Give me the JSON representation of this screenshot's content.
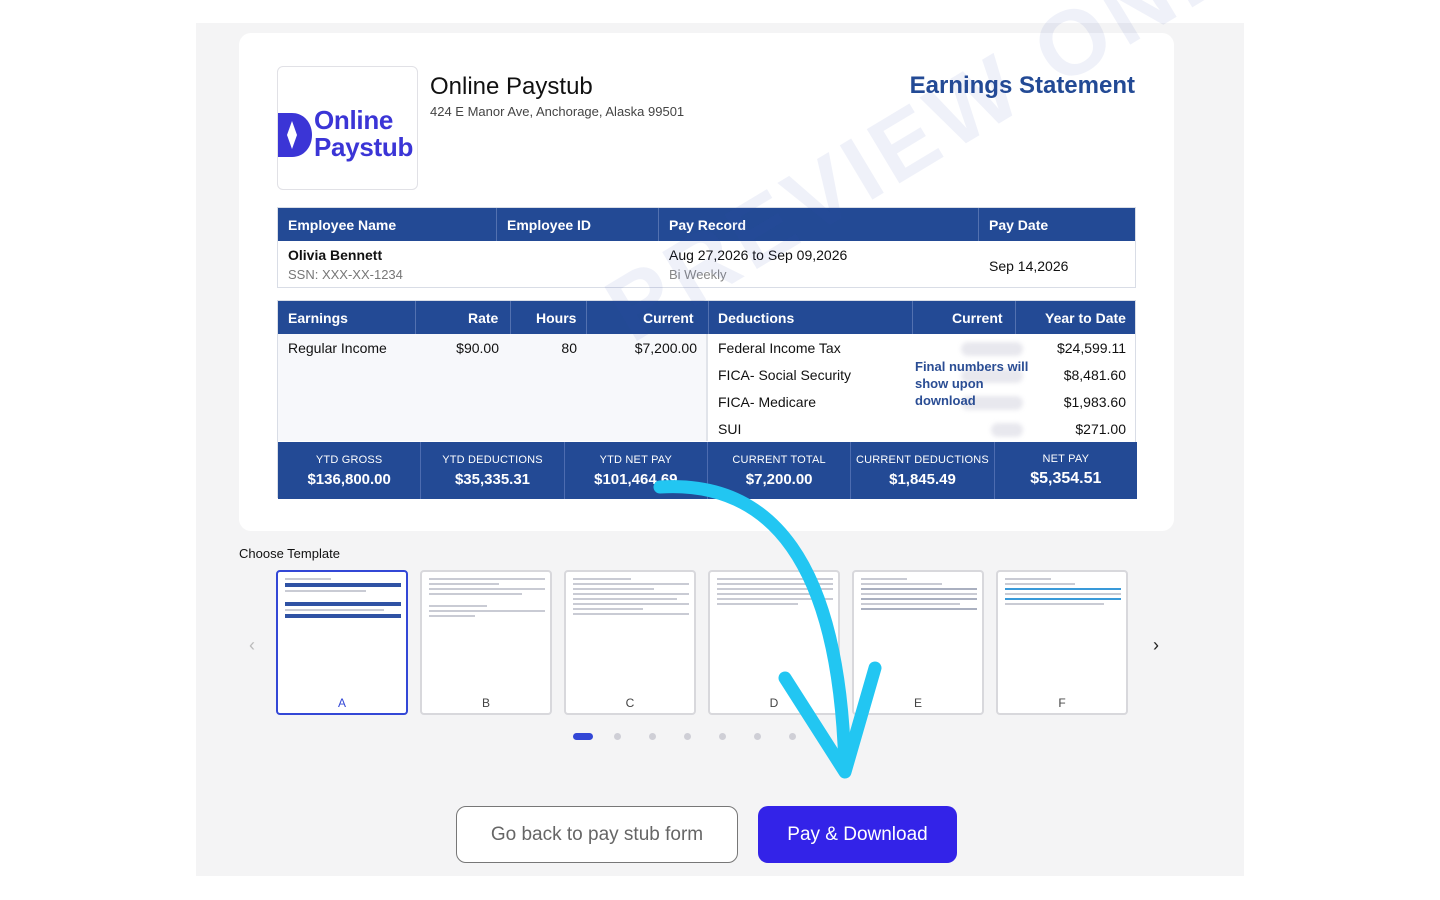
{
  "company": {
    "logo_line1": "Online",
    "logo_line2": "Paystub",
    "name": "Online Paystub",
    "address": "424 E Manor Ave, Anchorage, Alaska 99501",
    "statement_title": "Earnings Statement"
  },
  "employee_table": {
    "headers": [
      "Employee Name",
      "Employee ID",
      "Pay Record",
      "Pay Date"
    ],
    "employee_name": "Olivia Bennett",
    "ssn": "SSN: XXX-XX-1234",
    "pay_record": "Aug 27,2026 to Sep 09,2026",
    "pay_frequency": "Bi Weekly",
    "pay_date": "Sep 14,2026"
  },
  "earnings": {
    "headers": [
      "Earnings",
      "Rate",
      "Hours",
      "Current"
    ],
    "rows": [
      {
        "label": "Regular Income",
        "rate": "$90.00",
        "hours": "80",
        "current": "$7,200.00"
      }
    ]
  },
  "deductions": {
    "headers": [
      "Deductions",
      "Current",
      "Year to Date"
    ],
    "rows": [
      {
        "label": "Federal Income Tax",
        "ytd": "$24,599.11"
      },
      {
        "label": "FICA- Social Security",
        "ytd": "$8,481.60"
      },
      {
        "label": "FICA- Medicare",
        "ytd": "$1,983.60"
      },
      {
        "label": "SUI",
        "ytd": "$271.00"
      }
    ],
    "final_note": "Final numbers will show upon download"
  },
  "summary": [
    {
      "label": "YTD GROSS",
      "value": "$136,800.00"
    },
    {
      "label": "YTD DEDUCTIONS",
      "value": "$35,335.31"
    },
    {
      "label": "YTD NET PAY",
      "value": "$101,464.69"
    },
    {
      "label": "CURRENT TOTAL",
      "value": "$7,200.00"
    },
    {
      "label": "CURRENT DEDUCTIONS",
      "value": "$1,845.49"
    },
    {
      "label": "NET PAY",
      "value": "$5,354.51"
    }
  ],
  "watermark": "PREVIEW ONLY",
  "templates": {
    "label": "Choose Template",
    "items": [
      "A",
      "B",
      "C",
      "D",
      "E",
      "F"
    ],
    "selected": "A",
    "prev_icon": "chevron-left-icon",
    "next_icon": "chevron-right-icon",
    "pages": 7,
    "current_page": 1
  },
  "buttons": {
    "back": "Go back to pay stub form",
    "pay": "Pay & Download"
  },
  "colors": {
    "header_blue": "#234a95",
    "brand_purple": "#3323e8",
    "arrow_cyan": "#22c6f2"
  }
}
